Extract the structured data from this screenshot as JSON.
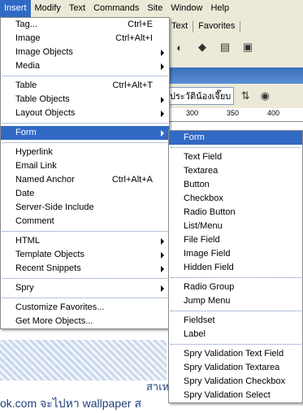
{
  "menubar": [
    "Insert",
    "Modify",
    "Text",
    "Commands",
    "Site",
    "Window",
    "Help"
  ],
  "background": {
    "tabs": [
      "Text",
      "Favorites"
    ],
    "doc_title": "ประวัติน้องเจี๊ยบ",
    "ruler_labels": [
      "300",
      "350",
      "400"
    ],
    "thai_line1": "สาเหตุที่ตั้งชื่อเว็",
    "thai_line2": "ok.com จะไปหา wallpaper ส"
  },
  "insert_menu": [
    {
      "type": "item",
      "label": "Tag...",
      "shortcut": "Ctrl+E"
    },
    {
      "type": "item",
      "label": "Image",
      "shortcut": "Ctrl+Alt+I"
    },
    {
      "type": "item",
      "label": "Image Objects",
      "submenu": true
    },
    {
      "type": "item",
      "label": "Media",
      "submenu": true
    },
    {
      "type": "sep"
    },
    {
      "type": "item",
      "label": "Table",
      "shortcut": "Ctrl+Alt+T"
    },
    {
      "type": "item",
      "label": "Table Objects",
      "submenu": true
    },
    {
      "type": "item",
      "label": "Layout Objects",
      "submenu": true
    },
    {
      "type": "sep"
    },
    {
      "type": "item",
      "label": "Form",
      "submenu": true,
      "highlighted": true
    },
    {
      "type": "sep"
    },
    {
      "type": "item",
      "label": "Hyperlink"
    },
    {
      "type": "item",
      "label": "Email Link"
    },
    {
      "type": "item",
      "label": "Named Anchor",
      "shortcut": "Ctrl+Alt+A"
    },
    {
      "type": "item",
      "label": "Date"
    },
    {
      "type": "item",
      "label": "Server-Side Include"
    },
    {
      "type": "item",
      "label": "Comment"
    },
    {
      "type": "sep"
    },
    {
      "type": "item",
      "label": "HTML",
      "submenu": true
    },
    {
      "type": "item",
      "label": "Template Objects",
      "submenu": true
    },
    {
      "type": "item",
      "label": "Recent Snippets",
      "submenu": true
    },
    {
      "type": "sep"
    },
    {
      "type": "item",
      "label": "Spry",
      "submenu": true
    },
    {
      "type": "sep"
    },
    {
      "type": "item",
      "label": "Customize Favorites..."
    },
    {
      "type": "item",
      "label": "Get More Objects..."
    }
  ],
  "form_menu": [
    {
      "type": "item",
      "label": "Form",
      "highlighted": true
    },
    {
      "type": "sep"
    },
    {
      "type": "item",
      "label": "Text Field"
    },
    {
      "type": "item",
      "label": "Textarea"
    },
    {
      "type": "item",
      "label": "Button"
    },
    {
      "type": "item",
      "label": "Checkbox"
    },
    {
      "type": "item",
      "label": "Radio Button"
    },
    {
      "type": "item",
      "label": "List/Menu"
    },
    {
      "type": "item",
      "label": "File Field"
    },
    {
      "type": "item",
      "label": "Image Field"
    },
    {
      "type": "item",
      "label": "Hidden Field"
    },
    {
      "type": "sep"
    },
    {
      "type": "item",
      "label": "Radio Group"
    },
    {
      "type": "item",
      "label": "Jump Menu"
    },
    {
      "type": "sep"
    },
    {
      "type": "item",
      "label": "Fieldset"
    },
    {
      "type": "item",
      "label": "Label"
    },
    {
      "type": "sep"
    },
    {
      "type": "item",
      "label": "Spry Validation Text Field"
    },
    {
      "type": "item",
      "label": "Spry Validation Textarea"
    },
    {
      "type": "item",
      "label": "Spry Validation Checkbox"
    },
    {
      "type": "item",
      "label": "Spry Validation Select"
    }
  ]
}
